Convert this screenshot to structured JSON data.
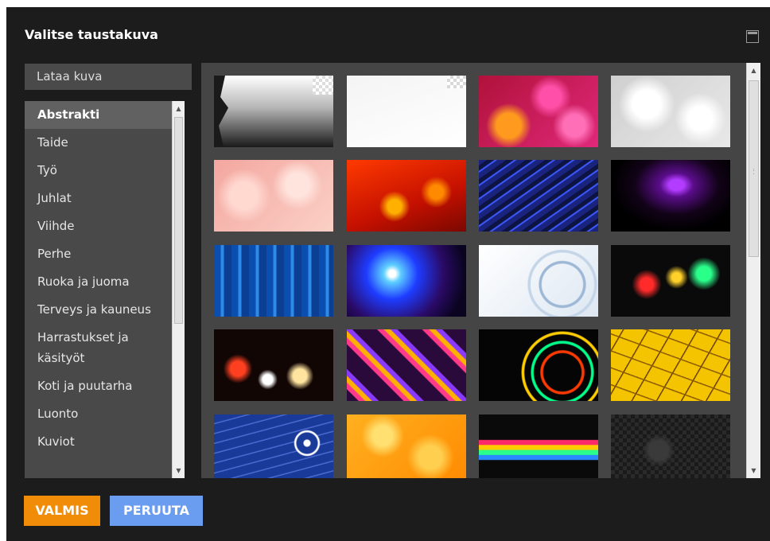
{
  "dialog": {
    "title": "Valitse taustakuva"
  },
  "upload_label": "Lataa kuva",
  "categories": [
    "Abstrakti",
    "Taide",
    "Työ",
    "Juhlat",
    "Viihde",
    "Perhe",
    "Ruoka ja juoma",
    "Terveys ja kauneus",
    "Harrastukset ja käsityöt",
    "Koti ja puutarha",
    "Luonto",
    "Kuviot"
  ],
  "selected_category": "Abstrakti",
  "buttons": {
    "done": "VALMIS",
    "cancel": "PERUUTA"
  },
  "thumbnails": [
    "black-white-gradient-splatter",
    "white-peeled-corner",
    "pink-orange-bokeh",
    "silver-bokeh",
    "pink-soft-bokeh",
    "red-orange-bokeh",
    "blue-light-streaks",
    "purple-lightning",
    "blue-vertical-streaks",
    "blue-light-burst",
    "white-blue-swirl",
    "colorful-bokeh-dark",
    "night-bokeh-lights",
    "purple-orange-retro-stripes",
    "neon-light-trails",
    "yellow-cracked-texture",
    "blue-circle-pattern",
    "orange-floral-swirls",
    "rainbow-stripes-dots",
    "black-ornament-pattern"
  ]
}
